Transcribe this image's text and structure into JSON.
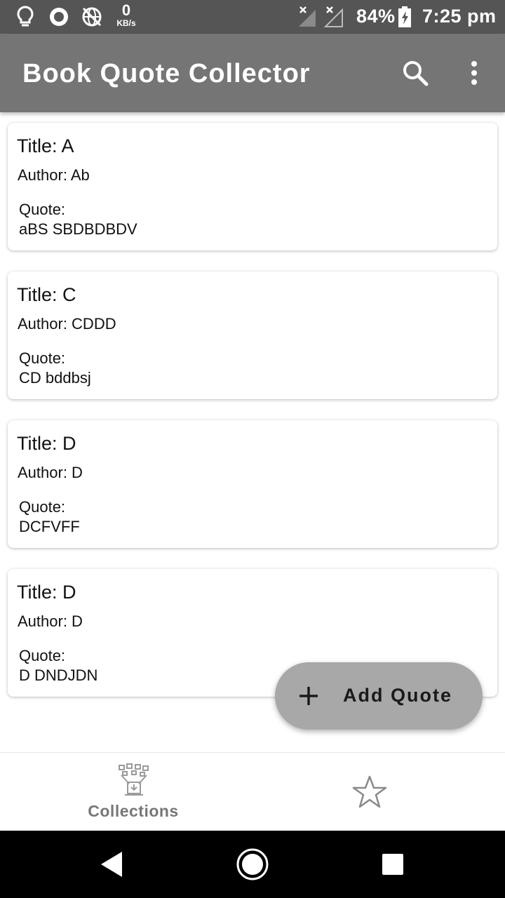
{
  "status_bar": {
    "speed_value": "0",
    "speed_unit": "KB/s",
    "battery": "84%",
    "time": "7:25 pm",
    "icons": [
      "lightbulb-icon",
      "record-icon",
      "globe-icon",
      "signal-off-icon",
      "signal-off-icon",
      "battery-charging-icon"
    ]
  },
  "app_bar": {
    "title": "Book Quote Collector",
    "icons": [
      "search-icon",
      "more-vert-icon"
    ]
  },
  "quotes": [
    {
      "title": "Title: A",
      "author": "Author: Ab",
      "quote_label": "Quote:",
      "quote": "aBS SBDBDBDV"
    },
    {
      "title": "Title: C",
      "author": "Author: CDDD",
      "quote_label": "Quote:",
      "quote": "CD bddbsj"
    },
    {
      "title": "Title: D",
      "author": "Author: D",
      "quote_label": "Quote:",
      "quote": "DCFVFF"
    },
    {
      "title": "Title: D",
      "author": "Author: D",
      "quote_label": "Quote:",
      "quote": "D DNDJDN"
    }
  ],
  "fab": {
    "label": "Add Quote",
    "icon": "plus-icon"
  },
  "bottom_nav": {
    "items": [
      {
        "label": "Collections",
        "icon": "collections-icon",
        "selected": true
      },
      {
        "label": "",
        "icon": "star-icon",
        "selected": false
      }
    ]
  },
  "system_nav": {
    "icons": [
      "back-icon",
      "home-icon",
      "recents-icon"
    ]
  },
  "colors": {
    "status_bar": "#555555",
    "app_bar": "#757575",
    "fab": "#a8a8a8",
    "nav_label": "#777777"
  }
}
